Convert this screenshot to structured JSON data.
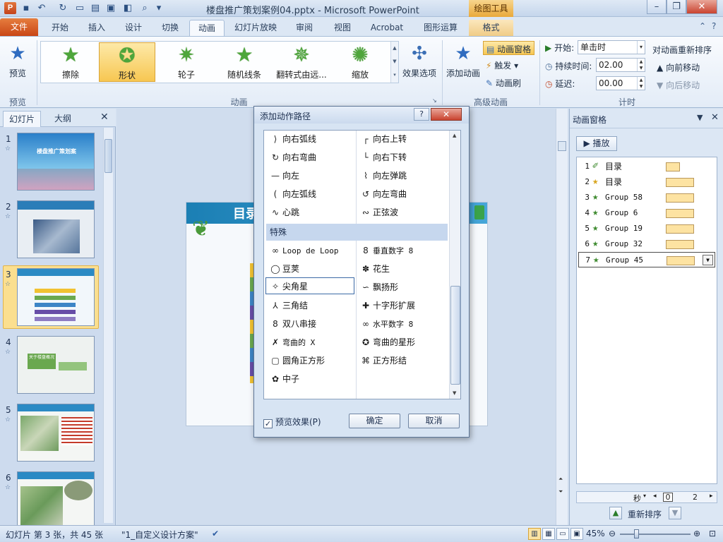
{
  "window": {
    "title": "楼盘推广策划案例04.pptx - Microsoft PowerPoint",
    "contextual_header": "绘图工具",
    "app_icon_letter": "P"
  },
  "tabs": [
    {
      "label": "文件"
    },
    {
      "label": "开始"
    },
    {
      "label": "插入"
    },
    {
      "label": "设计"
    },
    {
      "label": "切换"
    },
    {
      "label": "动画"
    },
    {
      "label": "幻灯片放映"
    },
    {
      "label": "审阅"
    },
    {
      "label": "视图"
    },
    {
      "label": "Acrobat"
    },
    {
      "label": "图形运算"
    },
    {
      "label": "格式"
    }
  ],
  "active_tab": "动画",
  "ribbon": {
    "preview": {
      "label": "预览",
      "group": "预览"
    },
    "gallery": [
      {
        "label": "擦除"
      },
      {
        "label": "形状"
      },
      {
        "label": "轮子"
      },
      {
        "label": "随机线条"
      },
      {
        "label": "翻转式由远..."
      },
      {
        "label": "缩放"
      }
    ],
    "gallery_selected": "形状",
    "effect_options": "效果选项",
    "animation_group": "动画",
    "add_animation": "添加动画",
    "animation_pane_btn": "动画窗格",
    "trigger": "触发",
    "painter": "动画刷",
    "advanced_group": "高级动画",
    "start_label": "开始:",
    "start_value": "单击时",
    "duration_label": "持续时间:",
    "duration_value": "02.00",
    "delay_label": "延迟:",
    "delay_value": "00.00",
    "reorder_title": "对动画重新排序",
    "move_earlier": "向前移动",
    "move_later": "向后移动",
    "timing_group": "计时"
  },
  "left_panel": {
    "tab_slides": "幻灯片",
    "tab_outline": "大纲",
    "slides": [
      {
        "num": "1",
        "caption": "楼盘推广策划案"
      },
      {
        "num": "2",
        "caption": ""
      },
      {
        "num": "3",
        "caption": "目录"
      },
      {
        "num": "4",
        "caption": "关于楼盘概况"
      },
      {
        "num": "5",
        "caption": ""
      },
      {
        "num": "6",
        "caption": ""
      }
    ],
    "selected_slide": "3"
  },
  "slide": {
    "title": "目录"
  },
  "dialog": {
    "title": "添加动作路径",
    "help": "?",
    "left_items_top": [
      {
        "glyph": "⟩",
        "label": "向右弧线"
      },
      {
        "glyph": "↻",
        "label": "向右弯曲"
      },
      {
        "glyph": "—",
        "label": "向左"
      },
      {
        "glyph": "(",
        "label": "向左弧线"
      },
      {
        "glyph": "∿",
        "label": "心跳"
      }
    ],
    "right_items_top": [
      {
        "glyph": "┌",
        "label": "向右上转"
      },
      {
        "glyph": "└",
        "label": "向右下转"
      },
      {
        "glyph": "⌇",
        "label": "向左弹跳"
      },
      {
        "glyph": "↺",
        "label": "向左弯曲"
      },
      {
        "glyph": "∾",
        "label": "正弦波"
      }
    ],
    "section": "特殊",
    "left_items_special": [
      {
        "glyph": "∞",
        "label": "Loop de Loop",
        "mono": true
      },
      {
        "glyph": "◯",
        "label": "豆荚"
      },
      {
        "glyph": "✧",
        "label": "尖角星",
        "selected": true
      },
      {
        "glyph": "⅄",
        "label": "三角结"
      },
      {
        "glyph": "8",
        "label": "双八串接"
      },
      {
        "glyph": "✗",
        "label": "弯曲的 X",
        "mono": true
      },
      {
        "glyph": "▢",
        "label": "圆角正方形"
      },
      {
        "glyph": "✿",
        "label": "中子"
      }
    ],
    "right_items_special": [
      {
        "glyph": "8",
        "label": "垂直数字 8",
        "mono": true
      },
      {
        "glyph": "✽",
        "label": "花生"
      },
      {
        "glyph": "∽",
        "label": "飘扬形"
      },
      {
        "glyph": "✚",
        "label": "十字形扩展"
      },
      {
        "glyph": "∞",
        "label": "水平数字 8",
        "mono": true
      },
      {
        "glyph": "✪",
        "label": "弯曲的星形"
      },
      {
        "glyph": "⌘",
        "label": "正方形结"
      }
    ],
    "preview_label": "预览效果(P)",
    "preview_checked": true,
    "ok": "确定",
    "cancel": "取消"
  },
  "anim_pane": {
    "title": "动画窗格",
    "play": "播放",
    "items": [
      {
        "num": "1",
        "name": "目录",
        "mono": false
      },
      {
        "num": "2",
        "name": "目录",
        "mono": false
      },
      {
        "num": "3",
        "name": "Group 58",
        "mono": true
      },
      {
        "num": "4",
        "name": "Group 6",
        "mono": true
      },
      {
        "num": "5",
        "name": "Group 19",
        "mono": true
      },
      {
        "num": "6",
        "name": "Group 32",
        "mono": true
      },
      {
        "num": "7",
        "name": "Group 45",
        "mono": true
      }
    ],
    "timeline_unit": "秒",
    "timeline_0": "0",
    "timeline_2": "2",
    "reorder": "重新排序"
  },
  "statusbar": {
    "slide_info": "幻灯片 第 3 张，共 45 张",
    "theme": "\"1_自定义设计方案\"",
    "zoom": "45%"
  },
  "colors": {
    "accent": "#c94716",
    "selection": "#f7c752",
    "title_bar": "#c5d6ec"
  }
}
